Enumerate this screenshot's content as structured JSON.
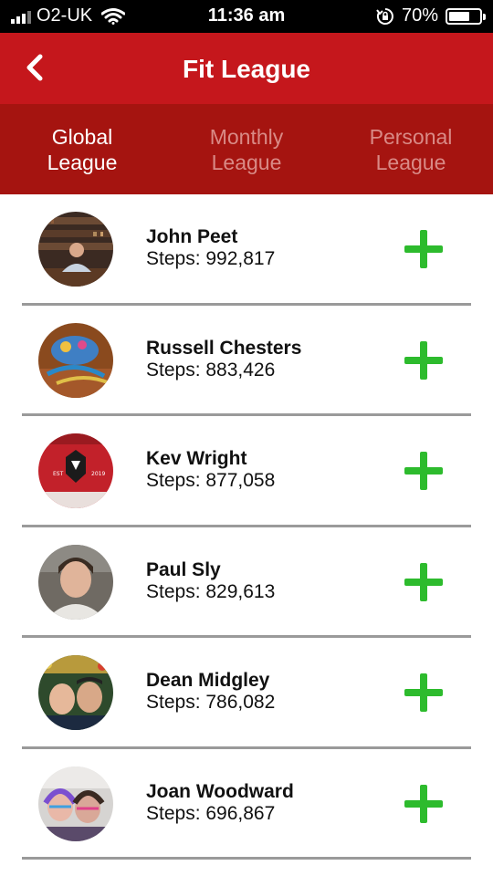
{
  "status_bar": {
    "carrier": "O2-UK",
    "time": "11:36 am",
    "battery": "70%",
    "battery_level": 0.7
  },
  "header": {
    "title": "Fit League",
    "back_icon": "chevron-left-icon"
  },
  "tabs": [
    {
      "label": "Global\nLeague",
      "active": true
    },
    {
      "label": "Monthly\nLeague",
      "active": false
    },
    {
      "label": "Personal\nLeague",
      "active": false
    }
  ],
  "entries": [
    {
      "name": "John Peet",
      "steps": "Steps: 992,817"
    },
    {
      "name": "Russell Chesters",
      "steps": "Steps: 883,426"
    },
    {
      "name": "Kev Wright",
      "steps": "Steps: 877,058"
    },
    {
      "name": "Paul Sly",
      "steps": "Steps: 829,613"
    },
    {
      "name": "Dean Midgley",
      "steps": "Steps: 786,082"
    },
    {
      "name": "Joan Woodward",
      "steps": "Steps: 696,867"
    }
  ],
  "colors": {
    "header": "#c5171c",
    "tabs": "#a51410",
    "add": "#2dbb2d"
  }
}
